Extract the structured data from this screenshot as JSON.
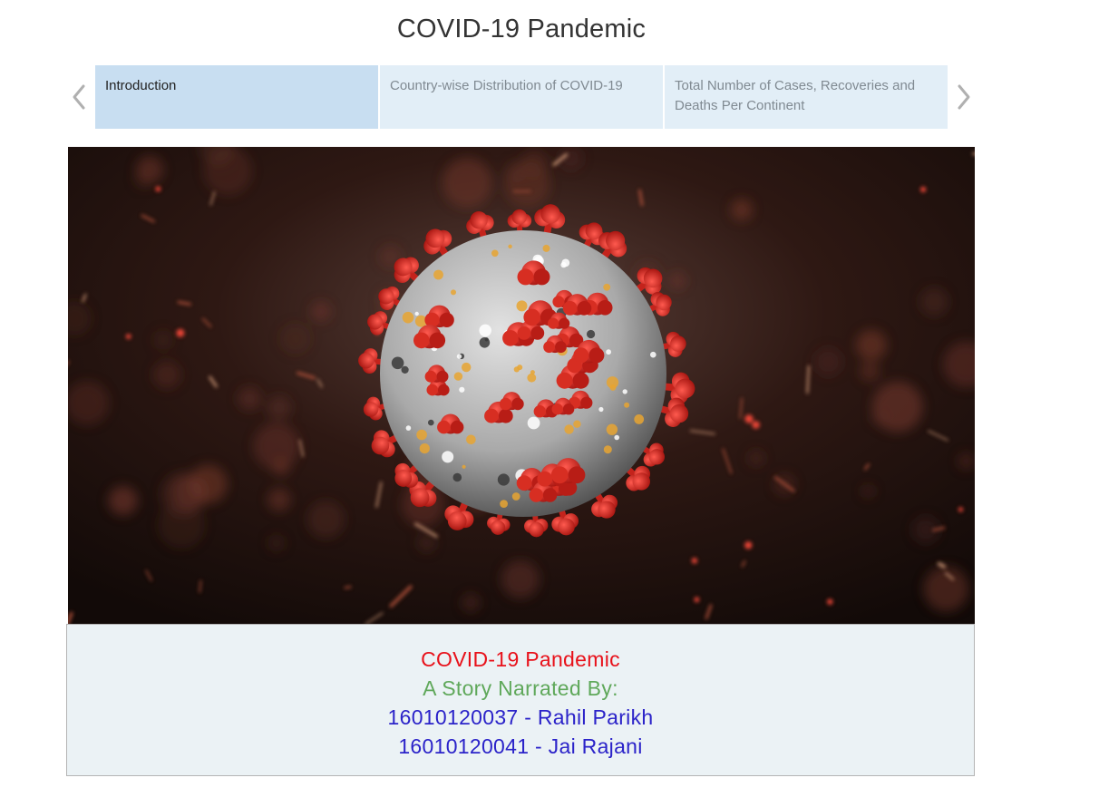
{
  "story": {
    "title": "COVID-19 Pandemic"
  },
  "navigation": {
    "prev_icon": "chevron-left-icon",
    "next_icon": "chevron-right-icon",
    "arrow_color": "#b0b0b0"
  },
  "tabs": [
    {
      "label": "Introduction",
      "active": true
    },
    {
      "label": "Country-wise Distribution of COVID-19",
      "active": false
    },
    {
      "label": "Total Number of Cases, Recoveries and Deaths Per Continent",
      "active": false
    }
  ],
  "image": {
    "subject": "coronavirus-illustration"
  },
  "caption": {
    "title": "COVID-19 Pandemic",
    "subtitle": "A Story Narrated By:",
    "authors": [
      "16010120037 - Rahil Parikh",
      "16010120041 - Jai Rajani"
    ]
  },
  "colors": {
    "tab_active_bg": "#c8def1",
    "tab_inactive_bg": "#e2eef7",
    "caption_title": "#e8111a",
    "caption_subtitle": "#5fa85a",
    "caption_authors": "#2b23c9"
  }
}
